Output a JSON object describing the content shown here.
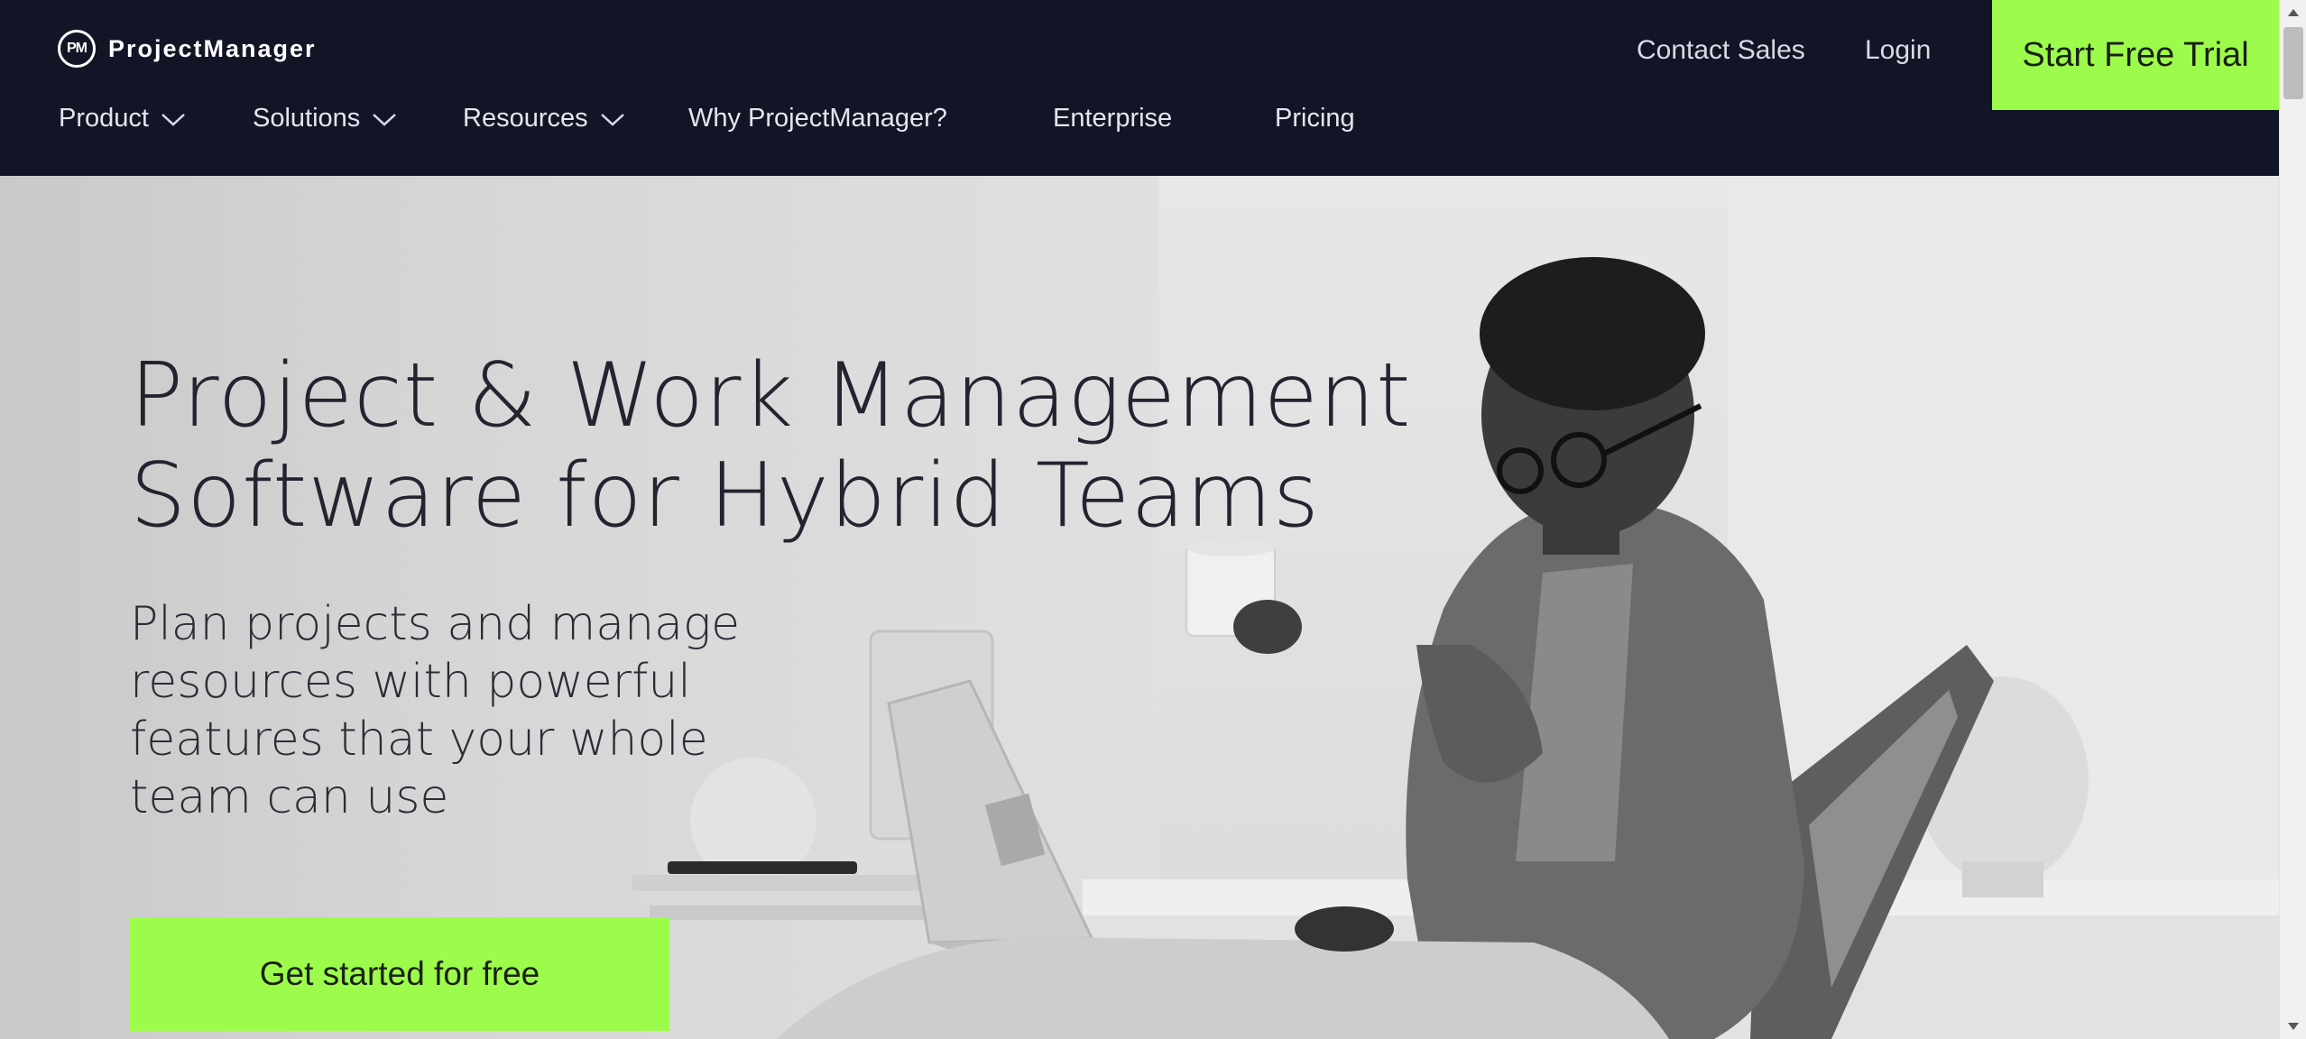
{
  "header": {
    "logo_mark": "PM",
    "brand": "ProjectManager",
    "contact_sales": "Contact Sales",
    "login": "Login",
    "start_trial": "Start Free Trial",
    "nav": {
      "product": "Product",
      "solutions": "Solutions",
      "resources": "Resources",
      "why": "Why ProjectManager?",
      "enterprise": "Enterprise",
      "pricing": "Pricing"
    }
  },
  "hero": {
    "headline_line1": "Project & Work Management",
    "headline_line2": "Software for Hybrid Teams",
    "sub_line1": "Plan projects and manage",
    "sub_line2": "resources with powerful",
    "sub_line3": "features that your whole",
    "sub_line4": "team can use",
    "cta": "Get started for free"
  },
  "colors": {
    "header_bg": "#121526",
    "accent_green": "#9dfb4c",
    "headline_text": "#22242f"
  },
  "icons": {
    "dropdown": "chevron-down-icon",
    "scroll_up": "arrow-up-icon",
    "scroll_down": "arrow-down-icon"
  }
}
